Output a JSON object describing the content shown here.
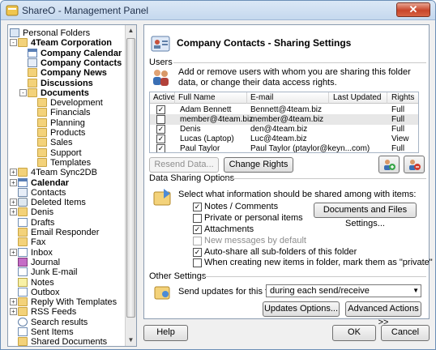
{
  "window": {
    "title": "ShareO - Management Panel",
    "close_glyph": "✕"
  },
  "tree": {
    "items": [
      {
        "label": "Personal Folders",
        "icon": "personal-folders-icon",
        "bold": false
      },
      {
        "label": "4Team Corporation",
        "icon": "folder-icon",
        "bold": true
      },
      {
        "label": "Company Calendar",
        "icon": "calendar-icon",
        "bold": true
      },
      {
        "label": "Company Contacts",
        "icon": "contacts-icon",
        "bold": true
      },
      {
        "label": "Company News",
        "icon": "folder-icon",
        "bold": true
      },
      {
        "label": "Discussions",
        "icon": "folder-icon",
        "bold": true
      },
      {
        "label": "Documents",
        "icon": "folder-icon",
        "bold": true
      },
      {
        "label": "Development",
        "icon": "folder-icon",
        "bold": false
      },
      {
        "label": "Financials",
        "icon": "folder-icon",
        "bold": false
      },
      {
        "label": "Planning",
        "icon": "folder-icon",
        "bold": false
      },
      {
        "label": "Products",
        "icon": "folder-icon",
        "bold": false
      },
      {
        "label": "Sales",
        "icon": "folder-icon",
        "bold": false
      },
      {
        "label": "Support",
        "icon": "folder-icon",
        "bold": false
      },
      {
        "label": "Templates",
        "icon": "folder-icon",
        "bold": false
      },
      {
        "label": "4Team Sync2DB",
        "icon": "folder-icon",
        "bold": false
      },
      {
        "label": "Calendar",
        "icon": "calendar-icon",
        "bold": true
      },
      {
        "label": "Contacts",
        "icon": "contacts-icon",
        "bold": false
      },
      {
        "label": "Deleted Items",
        "icon": "trash-icon",
        "bold": false
      },
      {
        "label": "Denis",
        "icon": "folder-icon",
        "bold": false
      },
      {
        "label": "Drafts",
        "icon": "mail-icon",
        "bold": false
      },
      {
        "label": "Email Responder",
        "icon": "folder-icon",
        "bold": false
      },
      {
        "label": "Fax",
        "icon": "folder-icon",
        "bold": false
      },
      {
        "label": "Inbox",
        "icon": "mail-icon",
        "bold": false
      },
      {
        "label": "Journal",
        "icon": "journal-icon",
        "bold": false
      },
      {
        "label": "Junk E-mail",
        "icon": "mail-icon",
        "bold": false
      },
      {
        "label": "Notes",
        "icon": "notes-icon",
        "bold": false
      },
      {
        "label": "Outbox",
        "icon": "mail-icon",
        "bold": false
      },
      {
        "label": "Reply With Templates",
        "icon": "folder-icon",
        "bold": false
      },
      {
        "label": "RSS Feeds",
        "icon": "folder-icon",
        "bold": false
      },
      {
        "label": "Search results",
        "icon": "search-icon",
        "bold": false
      },
      {
        "label": "Sent Items",
        "icon": "mail-icon",
        "bold": false
      },
      {
        "label": "Shared Documents",
        "icon": "folder-icon",
        "bold": false
      }
    ]
  },
  "header": {
    "title": "Company Contacts - Sharing Settings"
  },
  "users": {
    "section": "Users",
    "description": "Add or remove users with whom you are sharing this folder data, or change their data access rights.",
    "columns": [
      "Active",
      "Full Name",
      "E-mail",
      "Last Updated",
      "Rights"
    ],
    "rows": [
      {
        "active": true,
        "name": "Adam Bennett",
        "email": "Bennett@4team.biz",
        "updated": "",
        "rights": "Full"
      },
      {
        "active": false,
        "name": "member@4team.biz",
        "email": "member@4team.biz",
        "updated": "",
        "rights": "Full"
      },
      {
        "active": true,
        "name": "Denis",
        "email": "den@4team.biz",
        "updated": "",
        "rights": "Full"
      },
      {
        "active": true,
        "name": "Lucas (Laptop)",
        "email": "Luc@4team.biz",
        "updated": "",
        "rights": "View"
      },
      {
        "active": true,
        "name": "Paul Taylor",
        "email": "Paul Taylor (ptaylor@keyn...com)",
        "updated": "",
        "rights": "Full"
      }
    ],
    "resend_label": "Resend Data...",
    "change_rights_label": "Change Rights"
  },
  "sharing": {
    "section": "Data Sharing Options",
    "prompt": "Select what information should be shared among with items:",
    "options": [
      {
        "label": "Notes / Comments",
        "checked": true,
        "disabled": false
      },
      {
        "label": "Private or personal items",
        "checked": false,
        "disabled": false
      },
      {
        "label": "Attachments",
        "checked": true,
        "disabled": false
      },
      {
        "label": "New messages by default",
        "checked": false,
        "disabled": true
      },
      {
        "label": "Auto-share all sub-folders of this folder",
        "checked": true,
        "disabled": false
      },
      {
        "label": "When creating new items in folder, mark them as \"private\" by default",
        "checked": false,
        "disabled": false
      }
    ],
    "docs_button": "Documents and Files Settings..."
  },
  "other": {
    "section": "Other Settings",
    "send_label": "Send updates for this folder",
    "send_value": "during each send/receive",
    "updates_button": "Updates Options...",
    "advanced_button": "Advanced Actions >>"
  },
  "footer": {
    "help": "Help",
    "ok": "OK",
    "cancel": "Cancel"
  }
}
